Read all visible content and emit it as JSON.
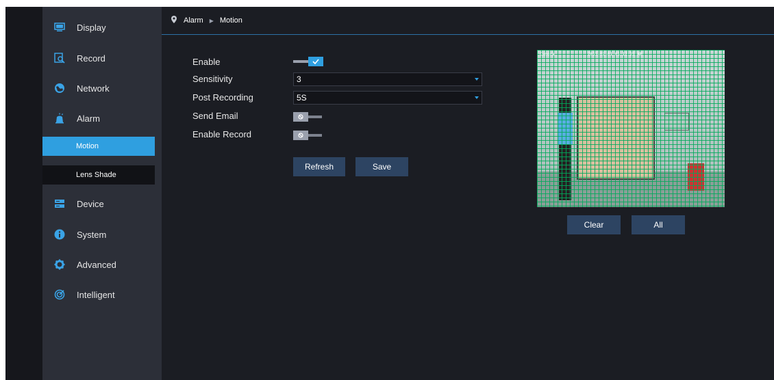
{
  "sidebar": {
    "items": [
      {
        "label": "Display",
        "icon": "display-icon"
      },
      {
        "label": "Record",
        "icon": "record-icon"
      },
      {
        "label": "Network",
        "icon": "network-icon"
      },
      {
        "label": "Alarm",
        "icon": "alarm-icon"
      },
      {
        "label": "Device",
        "icon": "device-icon"
      },
      {
        "label": "System",
        "icon": "info-icon"
      },
      {
        "label": "Advanced",
        "icon": "gear-icon"
      },
      {
        "label": "Intelligent",
        "icon": "intelligent-icon"
      }
    ],
    "subitems": [
      {
        "label": "Motion",
        "active": true
      },
      {
        "label": "Lens Shade",
        "active": false
      }
    ]
  },
  "breadcrumb": {
    "section": "Alarm",
    "page": "Motion"
  },
  "form": {
    "enable": {
      "label": "Enable",
      "value": true
    },
    "sensitivity": {
      "label": "Sensitivity",
      "value": "3"
    },
    "post_recording": {
      "label": "Post Recording",
      "value": "5S"
    },
    "send_email": {
      "label": "Send Email",
      "value": false
    },
    "enable_record": {
      "label": "Enable Record",
      "value": false
    }
  },
  "buttons": {
    "refresh": "Refresh",
    "save": "Save",
    "clear": "Clear",
    "all": "All"
  },
  "preview": {
    "osd_channel": "Camera",
    "osd_time": "2015-01-01 01:12:25 AM"
  },
  "colors": {
    "accent": "#2f9fe0",
    "button": "#2d4462",
    "sidebar": "#2c2f38",
    "grid": "#00aa5a"
  }
}
